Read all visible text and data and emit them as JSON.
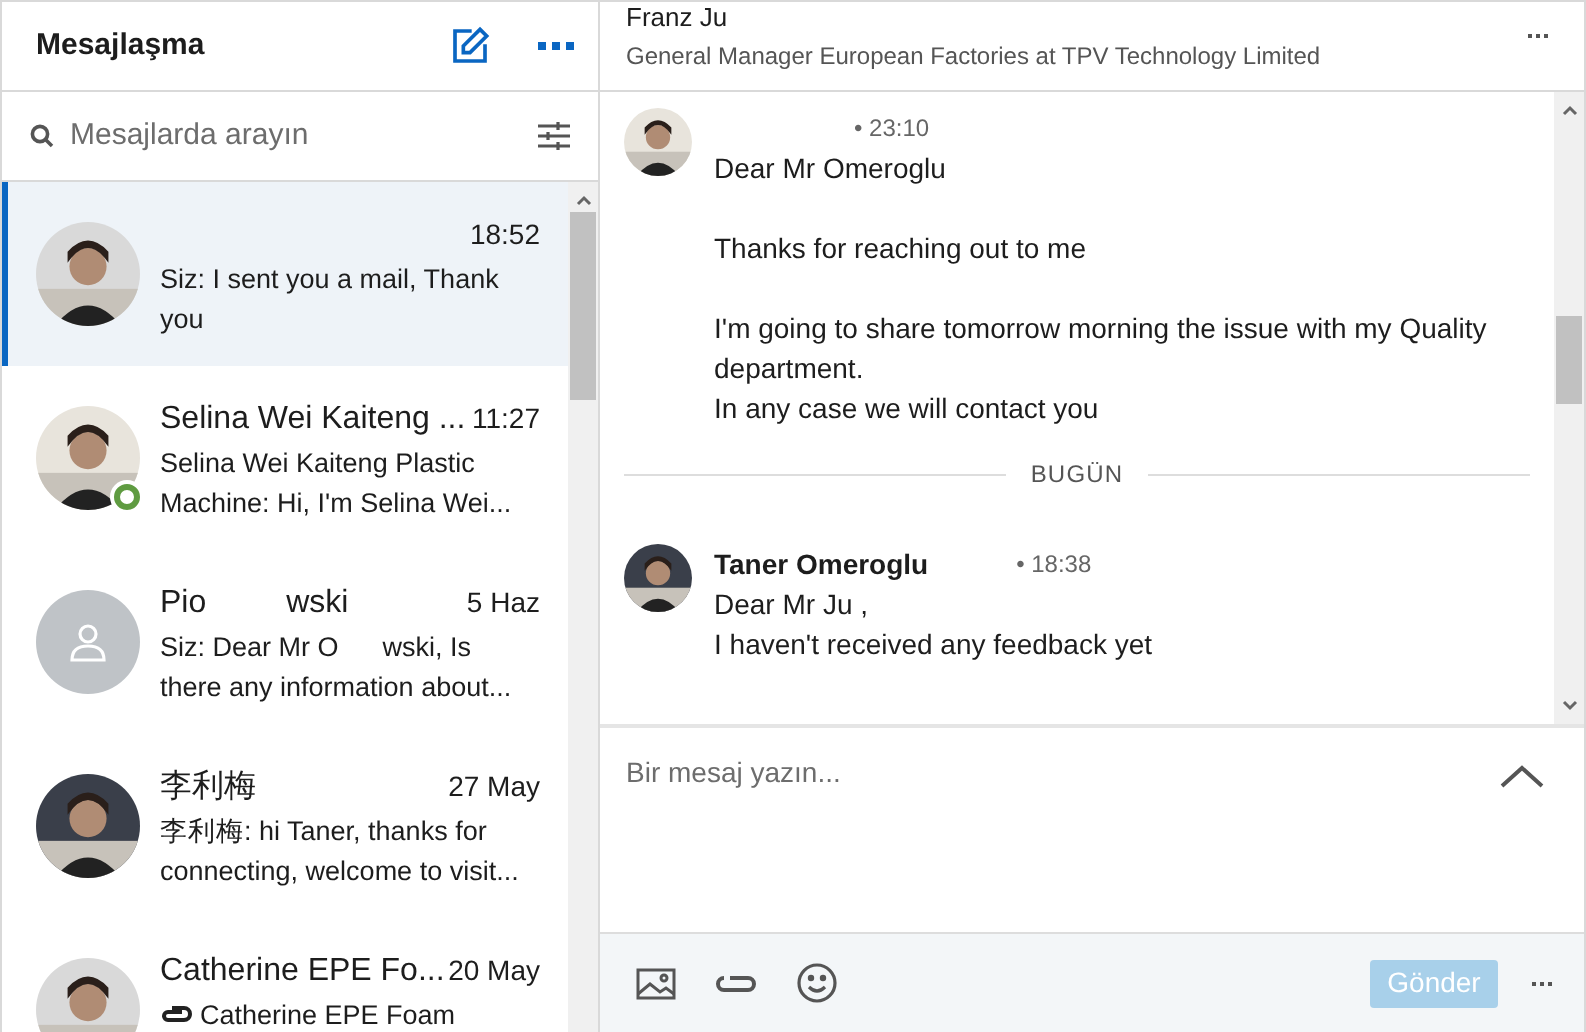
{
  "sidebar": {
    "title": "Mesajlaşma",
    "search": {
      "placeholder": "Mesajlarda arayın"
    },
    "conversations": [
      {
        "time": "18:52",
        "preview_parts": [
          "Siz: I sent you a mail,   Thank you"
        ],
        "selected": true,
        "online": false,
        "has_photo": true,
        "preview_icon": false
      },
      {
        "name_parts": [
          "Selina Wei Kaiteng ..."
        ],
        "time": "11:27",
        "preview_parts": [
          "Selina Wei Kaiteng Plastic Machine: Hi, I'm Selina Wei..."
        ],
        "selected": false,
        "online": true,
        "has_photo": true,
        "preview_icon": false
      },
      {
        "name_parts": [
          "Pio",
          "wski"
        ],
        "time": "5 Haz",
        "preview_parts": [
          "Siz: Dear Mr O",
          "wski,   Is there any information about..."
        ],
        "selected": false,
        "online": false,
        "has_photo": false,
        "preview_icon": false
      },
      {
        "name_parts": [
          "李利梅"
        ],
        "time": "27 May",
        "preview_parts": [
          "李利梅: hi Taner, thanks for connecting, welcome to visit..."
        ],
        "selected": false,
        "online": false,
        "has_photo": true,
        "preview_icon": false
      },
      {
        "name_parts": [
          "Catherine EPE Fo..."
        ],
        "time": "20 May",
        "preview_parts": [
          "Catherine EPE Foam"
        ],
        "selected": false,
        "online": false,
        "has_photo": true,
        "preview_icon": true
      }
    ]
  },
  "conversation": {
    "name": "Franz Ju",
    "headline": "General Manager European Factories at TPV Technology Limited",
    "messages": [
      {
        "kind": "message",
        "time": "• 23:10",
        "paragraphs": [
          [
            "Dear Mr Omeroglu"
          ],
          [
            "Thanks for reaching out to me"
          ],
          [
            "I'm going to share tomorrow morning the issue with my Quality department.",
            "In any case we will contact you"
          ]
        ]
      },
      {
        "kind": "divider",
        "label": "BUGÜN"
      },
      {
        "kind": "message",
        "sender": "Taner Omeroglu",
        "time": "• 18:38",
        "paragraphs": [
          [
            "Dear Mr Ju  ,",
            "I haven't received any feedback yet"
          ]
        ]
      }
    ]
  },
  "composer": {
    "placeholder": "Bir mesaj yazın...",
    "send": {
      "label": "Gönder",
      "disabled": true
    }
  }
}
